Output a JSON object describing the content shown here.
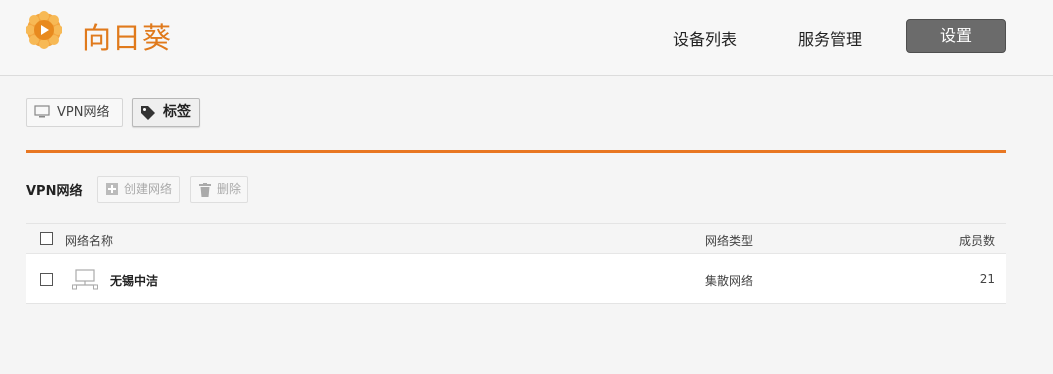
{
  "header": {
    "brand": "向日葵",
    "logo": "sunflower-logo",
    "nav": {
      "devices": "设备列表",
      "services": "服务管理",
      "settings": "设置"
    }
  },
  "tabs": {
    "vpn": {
      "label": "VPN网络",
      "icon": "monitor-icon"
    },
    "tags": {
      "label": "标签",
      "icon": "tag-icon"
    }
  },
  "accent_color": "#e87722",
  "section": {
    "title": "VPN网络",
    "create_label": "创建网络",
    "create_icon": "plus-square-icon",
    "delete_label": "删除",
    "delete_icon": "trash-icon"
  },
  "table": {
    "headers": {
      "name": "网络名称",
      "type": "网络类型",
      "members": "成员数"
    },
    "rows": [
      {
        "name": "无锡中洁",
        "type": "集散网络",
        "members": "21",
        "icon": "network-icon"
      }
    ]
  }
}
